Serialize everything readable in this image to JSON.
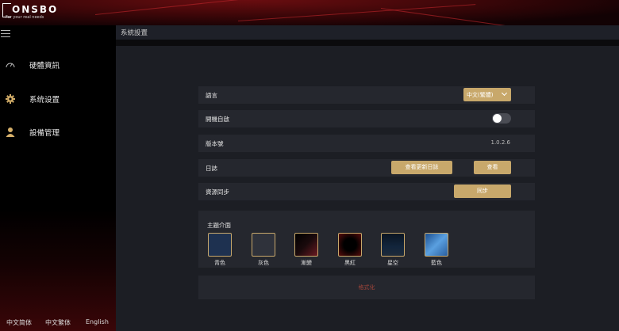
{
  "brand": {
    "name": "ONSBO",
    "tagline": "For your real needs"
  },
  "header": {
    "title": "系統設置"
  },
  "sidebar": {
    "items": [
      {
        "label": "硬體資訊",
        "icon": "gauge-icon"
      },
      {
        "label": "系统设置",
        "icon": "gear-icon"
      },
      {
        "label": "設備管理",
        "icon": "user-icon"
      }
    ],
    "languages": [
      "中文简体",
      "中文繁体",
      "English"
    ]
  },
  "settings": {
    "language": {
      "label": "語言",
      "value": "中文(繁體)"
    },
    "autostart": {
      "label": "開機自啟",
      "enabled": false
    },
    "version": {
      "label": "版本號",
      "value": "1.0.2.6"
    },
    "log": {
      "label": "日誌",
      "view_update_log": "查看更新日誌",
      "view": "查看"
    },
    "sync": {
      "label": "資源同步",
      "button": "同步"
    }
  },
  "theme": {
    "title": "主題介面",
    "options": [
      {
        "label": "青色",
        "color": "#1e3150"
      },
      {
        "label": "灰色",
        "color": "#2f323b"
      },
      {
        "label": "漸變",
        "color": "#3a1418"
      },
      {
        "label": "黑紅",
        "color": "#1a0606"
      },
      {
        "label": "星空",
        "color": "#0d1a2e"
      },
      {
        "label": "藍色",
        "color": "#3a74b8"
      }
    ]
  },
  "reset": {
    "label": "格式化"
  },
  "colors": {
    "accent": "#c8a86b",
    "background": "#1c1e24",
    "panel": "#25272e",
    "reset_text": "#a0453a"
  }
}
